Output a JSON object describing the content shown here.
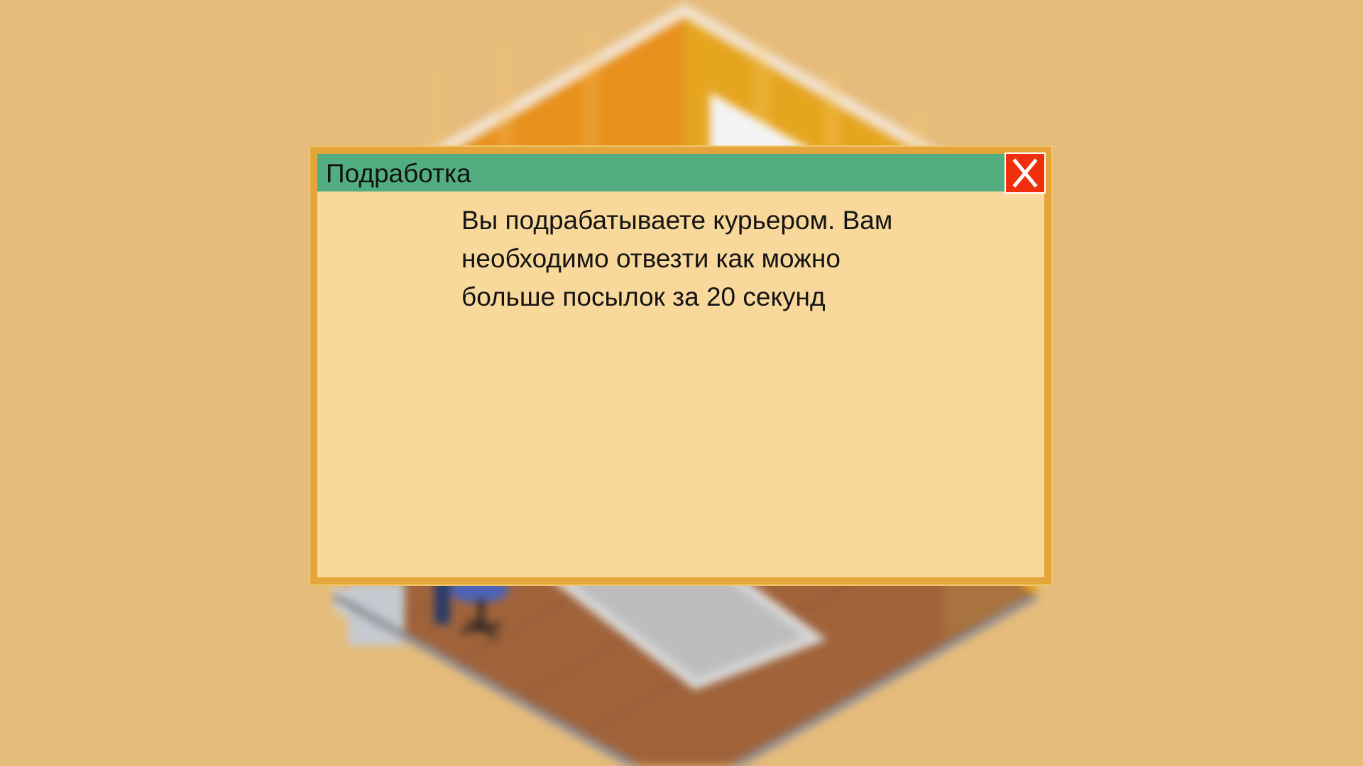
{
  "dialog": {
    "title": "Подработка",
    "close_label": "X",
    "message": "Вы подрабатываете курьером. Вам необходимо отвезти как можно больше посылок за 20 секунд"
  },
  "colors": {
    "background": "#e6bc7c",
    "dialog_body": "#f9d89b",
    "dialog_border": "#e6a53a",
    "titlebar": "#52ae80",
    "close_button": "#f0300d",
    "wall_orange": "#e89a1e",
    "floor_wood": "#a0633a"
  },
  "icons": {
    "close": "close-x-icon"
  }
}
